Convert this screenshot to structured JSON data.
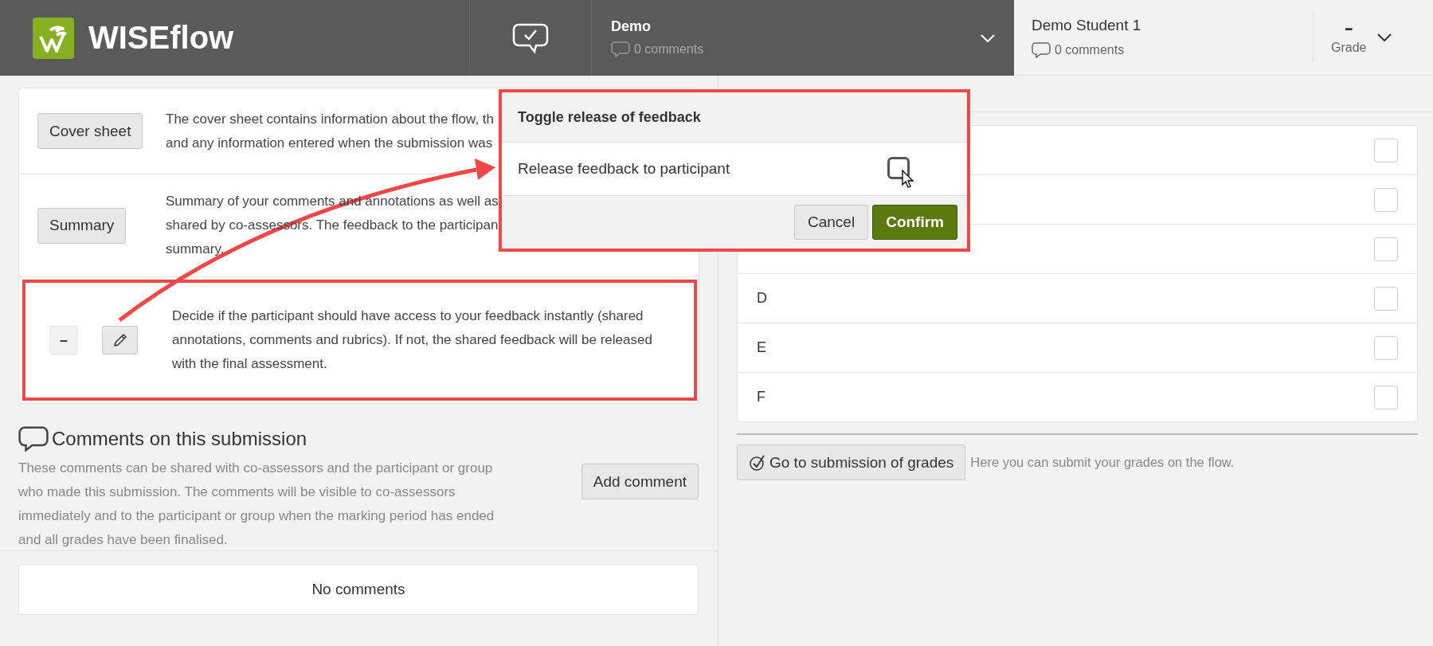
{
  "header": {
    "logo_text": "WISEflow",
    "flow": {
      "title": "Demo",
      "comments": "0 comments"
    },
    "participant": {
      "name": "Demo Student 1",
      "comments": "0 comments"
    },
    "grade": {
      "value": "–",
      "label": "Grade"
    }
  },
  "info_rows": [
    {
      "kind": "button",
      "button": "Cover sheet",
      "lines": [
        "The cover sheet contains information about the flow, th",
        "and any information entered when the submission was"
      ]
    },
    {
      "kind": "button",
      "button": "Summary",
      "lines": [
        "Summary of your comments and annotations as well as",
        "shared by co-assessors. The feedback to the participan",
        "summary."
      ]
    },
    {
      "kind": "release",
      "status": "–",
      "highlighted": true,
      "lines": [
        "Decide if the participant should have access to your feedback instantly (shared",
        "annotations, comments and rubrics). If not, the shared feedback will be released",
        "with the final assessment."
      ]
    }
  ],
  "popup": {
    "title": "Toggle release of feedback",
    "option": {
      "label": "Release feedback to participant",
      "checked": false
    },
    "buttons": [
      {
        "label": "Cancel",
        "kind": "secondary"
      },
      {
        "label": "Confirm",
        "kind": "primary"
      }
    ]
  },
  "comments": {
    "title": "Comments on this submission",
    "description": "These comments can be shared with co-assessors and the participant or group who made this submission. The comments will be visible to co-assessors immediately and to the participant or group when the marking period has ended and all grades have been finalised.",
    "add_button": "Add comment",
    "empty": "No comments"
  },
  "grades": [
    {
      "checked": false
    },
    {
      "checked": false
    },
    {
      "checked": false
    },
    {
      "label": "D",
      "checked": false
    },
    {
      "label": "E",
      "checked": false
    },
    {
      "label": "F",
      "checked": false
    }
  ],
  "submit": {
    "button": "Go to submission of grades",
    "hint": "Here you can submit your grades on the flow."
  }
}
